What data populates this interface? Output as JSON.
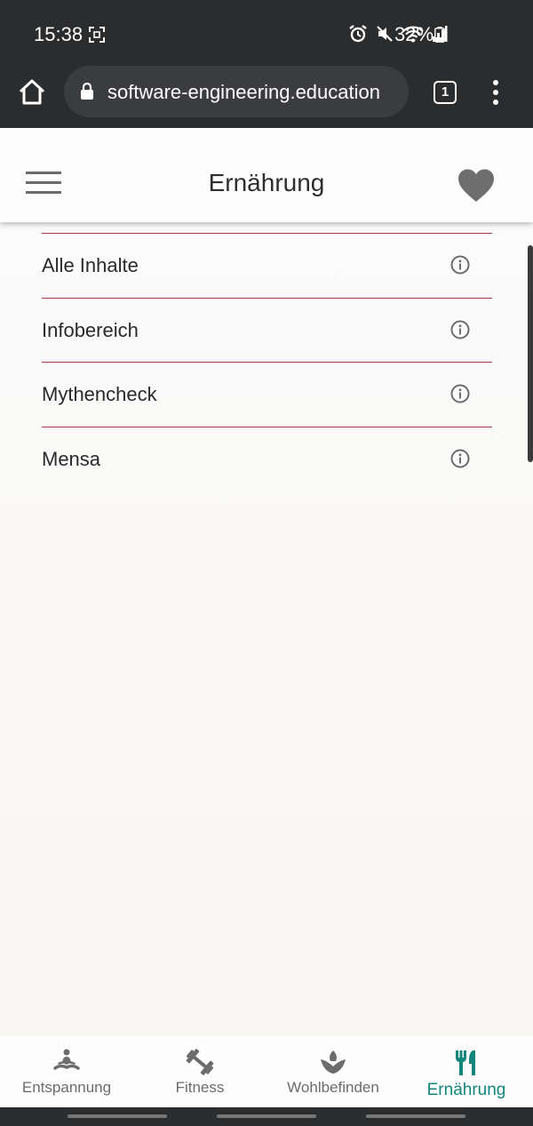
{
  "status_bar": {
    "time": "15:38",
    "battery": "32%",
    "icons": [
      "screenshot-icon",
      "alarm-icon",
      "mute-icon",
      "wifi-icon",
      "signal-icon",
      "battery-icon"
    ]
  },
  "browser": {
    "url": "software-engineering.education",
    "tab_count": "1"
  },
  "header": {
    "title": "Ernährung"
  },
  "menu": {
    "items": [
      {
        "label": "Alle Inhalte"
      },
      {
        "label": "Infobereich"
      },
      {
        "label": "Mythencheck"
      },
      {
        "label": "Mensa"
      }
    ]
  },
  "bottom_nav": {
    "items": [
      {
        "label": "Entspannung",
        "icon": "meditation-icon"
      },
      {
        "label": "Fitness",
        "icon": "dumbbell-icon"
      },
      {
        "label": "Wohlbefinden",
        "icon": "lotus-icon"
      },
      {
        "label": "Ernährung",
        "icon": "fork-knife-icon"
      }
    ],
    "active_index": 3
  },
  "colors": {
    "divider": "#a33a4e",
    "accent": "#12857d",
    "icon_gray": "#6b6b6b"
  }
}
